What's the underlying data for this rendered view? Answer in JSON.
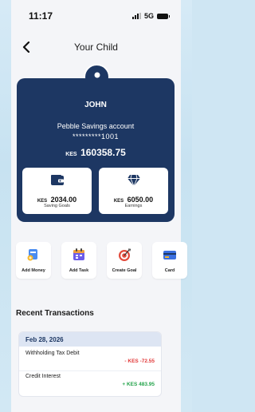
{
  "status_bar": {
    "time": "11:17",
    "network": "5G"
  },
  "header": {
    "title": "Your Child"
  },
  "account": {
    "name": "JOHN",
    "account_name": "Pebble Savings account",
    "masked_number": "*********1001",
    "currency": "KES",
    "balance": "160358.75"
  },
  "tiles": [
    {
      "currency": "KES",
      "value": "2034.00",
      "label": "Saving Goals",
      "icon": "wallet-icon"
    },
    {
      "currency": "KES",
      "value": "6050.00",
      "label": "Earnings",
      "icon": "diamond-icon"
    }
  ],
  "actions": [
    {
      "label": "Add Money",
      "icon": "add-money-icon"
    },
    {
      "label": "Add Task",
      "icon": "add-task-icon"
    },
    {
      "label": "Create Goal",
      "icon": "target-icon"
    },
    {
      "label": "Card",
      "icon": "card-icon"
    }
  ],
  "recent": {
    "title": "Recent Transactions",
    "date": "Feb 28, 2026",
    "items": [
      {
        "description": "Withholding Tax Debit",
        "amount": "- KES -72.55",
        "type": "debit"
      },
      {
        "description": "Credit Interest",
        "amount": "+ KES 483.95",
        "type": "credit"
      }
    ]
  },
  "colors": {
    "card_bg": "#1d3763",
    "page_bg": "#f4f5f8",
    "debit": "#e23838",
    "credit": "#23a34a",
    "date_bar": "#dde5f3"
  }
}
